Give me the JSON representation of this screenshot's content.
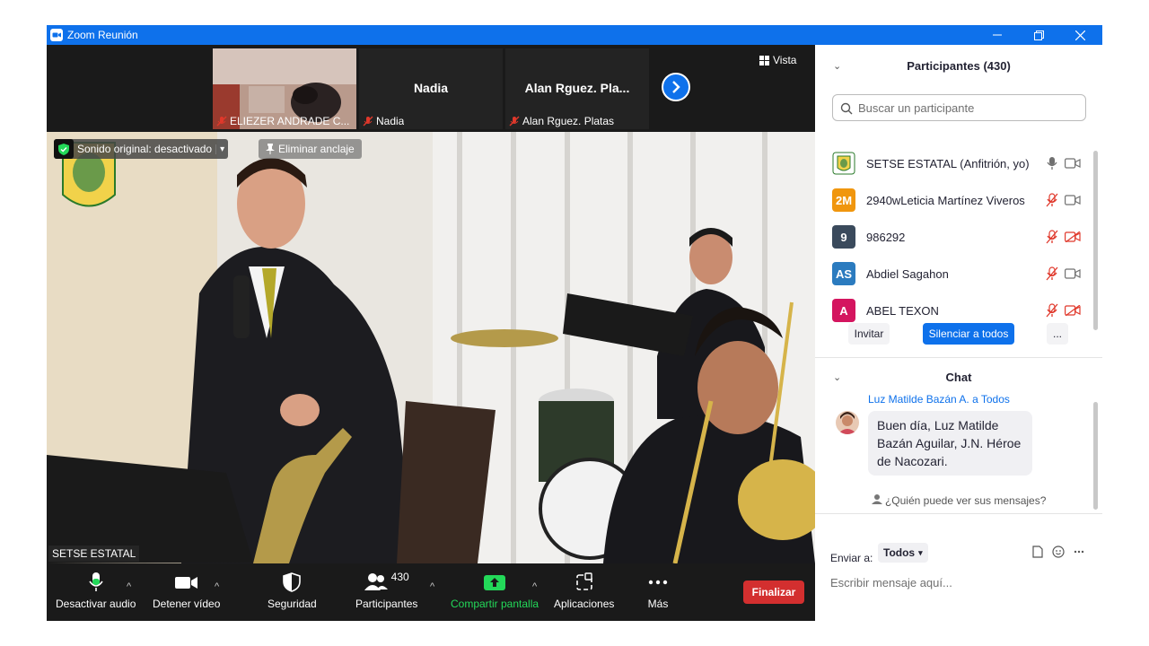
{
  "window": {
    "title": "Zoom Reunión"
  },
  "strip": {
    "thumbs": [
      {
        "name": "ELIEZER ANDRADE C...",
        "big_name": ""
      },
      {
        "name": "Nadia",
        "big_name": "Nadia"
      },
      {
        "name": "Alan  Rguez. Platas",
        "big_name": "Alan  Rguez. Pla..."
      }
    ],
    "view_label": "Vista"
  },
  "main_video": {
    "sound_pill": "Sonido original: desactivado",
    "unpin_label": "Eliminar anclaje",
    "name_tag": "SETSE ESTATAL"
  },
  "toolbar": {
    "mute": "Desactivar audio",
    "video": "Detener vídeo",
    "security": "Seguridad",
    "participants": "Participantes",
    "participants_count": "430",
    "share": "Compartir pantalla",
    "apps": "Aplicaciones",
    "more": "Más",
    "end": "Finalizar"
  },
  "participants_panel": {
    "title": "Participantes (430)",
    "search_placeholder": "Buscar un participante",
    "list": [
      {
        "initials": "",
        "name": "SETSE ESTATAL (Anfitrión, yo)",
        "color": "#ffffff",
        "mic": "on",
        "cam": "on"
      },
      {
        "initials": "2M",
        "name": "2940wLeticia Martínez Viveros",
        "color": "#f0960e",
        "mic": "off",
        "cam": "on"
      },
      {
        "initials": "9",
        "name": "986292",
        "color": "#3a4a5c",
        "mic": "off",
        "cam": "off"
      },
      {
        "initials": "AS",
        "name": "Abdiel Sagahon",
        "color": "#2b7bbf",
        "mic": "off",
        "cam": "on"
      },
      {
        "initials": "A",
        "name": "ABEL TEXON",
        "color": "#d4155f",
        "mic": "off",
        "cam": "off"
      }
    ],
    "invite": "Invitar",
    "mute_all": "Silenciar a todos",
    "more": "..."
  },
  "chat": {
    "title": "Chat",
    "from": "Luz Matilde Bazán A. a Todos",
    "message": "Buen día, Luz Matilde Bazán Aguilar, J.N. Héroe de Nacozari.",
    "who_can_see": "¿Quién puede ver sus mensajes?",
    "send_to_label": "Enviar a:",
    "send_to_value": "Todos",
    "input_placeholder": "Escribir mensaje aquí..."
  },
  "colors": {
    "accent": "#0e71eb",
    "end": "#d32f2f",
    "muted_red": "#e0382b",
    "share_green": "#23d959"
  }
}
